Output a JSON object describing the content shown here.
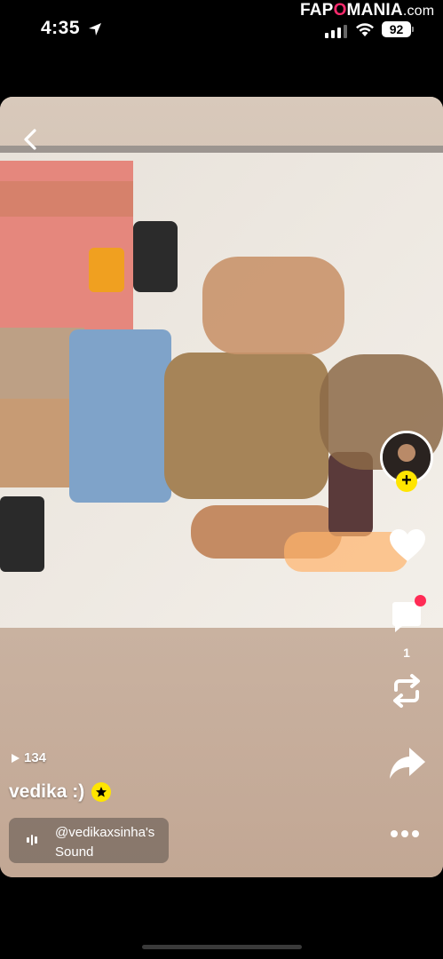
{
  "status_bar": {
    "time": "4:35",
    "battery": "92"
  },
  "watermark": {
    "brand_a": "FAP",
    "brand_o": "O",
    "brand_b": "MANIA",
    "domain": ".com"
  },
  "icons": {
    "back": "chevron-left-icon",
    "like": "heart-icon",
    "comment": "comment-icon",
    "repost": "repost-icon",
    "share": "share-arrow-icon",
    "more": "more-dots-icon",
    "play": "play-icon",
    "verified": "star-badge-icon",
    "sound": "sound-bars-icon"
  },
  "actions": {
    "comment_count": "1"
  },
  "post": {
    "views": "134",
    "username": "vedika :)",
    "sound_line1": "@vedikaxsinha's",
    "sound_line2": "Sound"
  },
  "colors": {
    "accent_yellow": "#ffe500",
    "notification_red": "#ff2b55"
  }
}
